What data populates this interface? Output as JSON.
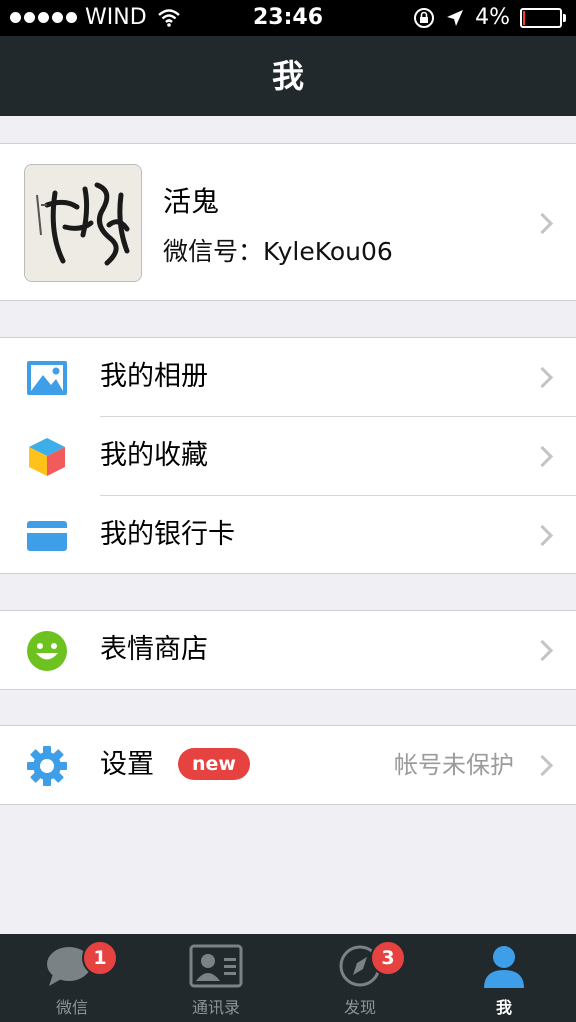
{
  "status_bar": {
    "carrier": "WIND",
    "time": "23:46",
    "battery_percent": "4%",
    "battery_level": 0.04
  },
  "nav": {
    "title": "我"
  },
  "profile": {
    "name": "活鬼",
    "wechat_id": "微信号：KyleKou06"
  },
  "menu": {
    "album": "我的相册",
    "favorites": "我的收藏",
    "bank_card": "我的银行卡",
    "sticker_store": "表情商店",
    "settings": "设置",
    "settings_badge": "new",
    "settings_hint": "帐号未保护"
  },
  "tabs": [
    {
      "label": "微信",
      "badge": "1"
    },
    {
      "label": "通讯录"
    },
    {
      "label": "发现",
      "badge": "3"
    },
    {
      "label": "我"
    }
  ],
  "colors": {
    "nav_bg": "#22292c",
    "accent_active": "#45c01a",
    "badge_red": "#e64340",
    "icon_blue": "#3e9ee8"
  },
  "icons": {
    "album": "photo-album-icon",
    "favorites": "cube-icon",
    "bank_card": "card-icon",
    "sticker_store": "smiley-icon",
    "settings": "gear-icon"
  }
}
